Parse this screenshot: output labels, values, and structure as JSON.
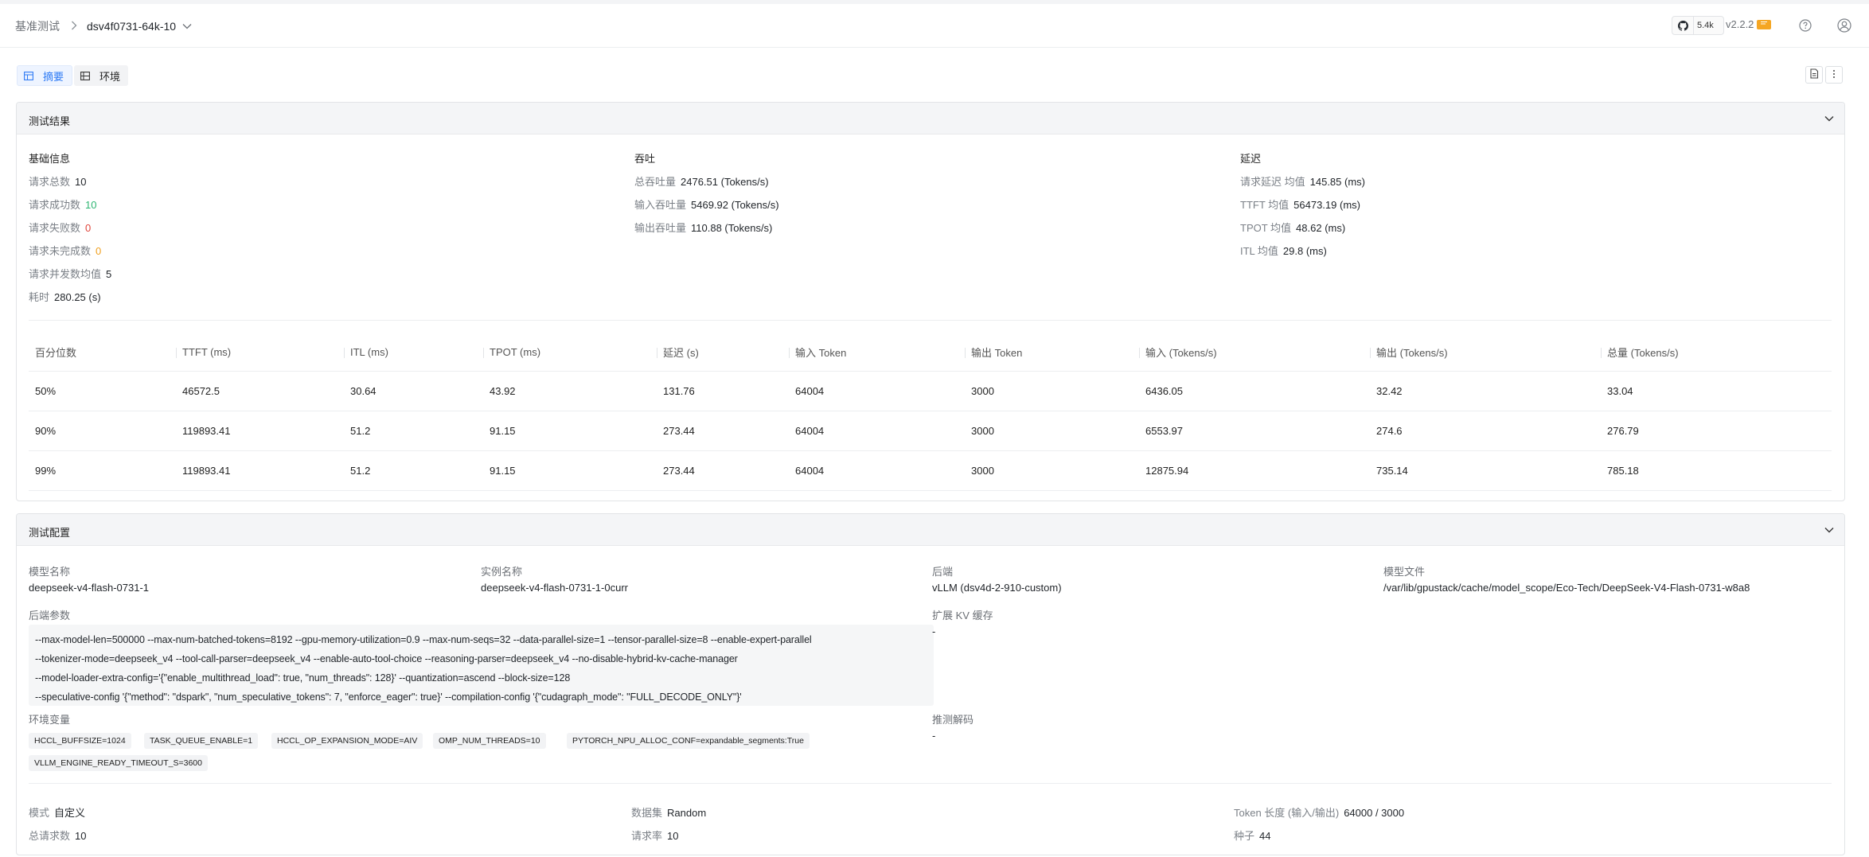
{
  "header": {
    "breadcrumb_root": "基准测试",
    "breadcrumb_current": "dsv4f0731-64k-10",
    "github_stars": "5.4k",
    "version": "v2.2.2"
  },
  "tabs": [
    {
      "label": "摘要"
    },
    {
      "label": "环境"
    }
  ],
  "results": {
    "title": "测试结果",
    "basic": {
      "title": "基础信息",
      "items": [
        {
          "label": "请求总数",
          "value": "10"
        },
        {
          "label": "请求成功数",
          "value": "10"
        },
        {
          "label": "请求失败数",
          "value": "0"
        },
        {
          "label": "请求未完成数",
          "value": "0"
        },
        {
          "label": "请求并发数均值",
          "value": "5"
        },
        {
          "label": "耗时",
          "value": "280.25 (s)"
        }
      ]
    },
    "throughput": {
      "title": "吞吐",
      "items": [
        {
          "label": "总吞吐量",
          "value": "2476.51 (Tokens/s)"
        },
        {
          "label": "输入吞吐量",
          "value": "5469.92 (Tokens/s)"
        },
        {
          "label": "输出吞吐量",
          "value": "110.88 (Tokens/s)"
        }
      ]
    },
    "latency": {
      "title": "延迟",
      "items": [
        {
          "label": "请求延迟 均值",
          "value": "145.85 (ms)"
        },
        {
          "label": "TTFT 均值",
          "value": "56473.19 (ms)"
        },
        {
          "label": "TPOT 均值",
          "value": "48.62 (ms)"
        },
        {
          "label": "ITL 均值",
          "value": "29.8 (ms)"
        }
      ]
    },
    "table": {
      "headers": [
        "百分位数",
        "TTFT (ms)",
        "ITL (ms)",
        "TPOT (ms)",
        "延迟 (s)",
        "输入 Token",
        "输出 Token",
        "输入 (Tokens/s)",
        "输出 (Tokens/s)",
        "总量 (Tokens/s)"
      ],
      "rows": [
        [
          "50%",
          "46572.5",
          "30.64",
          "43.92",
          "131.76",
          "64004",
          "3000",
          "6436.05",
          "32.42",
          "33.04"
        ],
        [
          "90%",
          "119893.41",
          "51.2",
          "91.15",
          "273.44",
          "64004",
          "3000",
          "6553.97",
          "274.6",
          "276.79"
        ],
        [
          "99%",
          "119893.41",
          "51.2",
          "91.15",
          "273.44",
          "64004",
          "3000",
          "12875.94",
          "735.14",
          "785.18"
        ]
      ]
    }
  },
  "config": {
    "title": "测试配置",
    "model_name_label": "模型名称",
    "model_name": "deepseek-v4-flash-0731-1",
    "instance_label": "实例名称",
    "instance": "deepseek-v4-flash-0731-1-0curr",
    "backend_label": "后端",
    "backend": "vLLM (dsv4d-2-910-custom)",
    "model_file_label": "模型文件",
    "model_file": "/var/lib/gpustack/cache/model_scope/Eco-Tech/DeepSeek-V4-Flash-0731-w8a8",
    "backend_args_label": "后端参数",
    "backend_args": [
      "--max-model-len=500000  --max-num-batched-tokens=8192  --gpu-memory-utilization=0.9  --max-num-seqs=32  --data-parallel-size=1  --tensor-parallel-size=8  --enable-expert-parallel",
      "--tokenizer-mode=deepseek_v4  --tool-call-parser=deepseek_v4  --enable-auto-tool-choice  --reasoning-parser=deepseek_v4  --no-disable-hybrid-kv-cache-manager",
      "--model-loader-extra-config='{\"enable_multithread_load\": true, \"num_threads\": 128}'  --quantization=ascend  --block-size=128",
      "--speculative-config '{\"method\": \"dspark\", \"num_speculative_tokens\": 7, \"enforce_eager\": true}'  --compilation-config '{\"cudagraph_mode\": \"FULL_DECODE_ONLY\"}'"
    ],
    "kv_cache_label": "扩展 KV 缓存",
    "kv_cache": "-",
    "env_label": "环境变量",
    "env_vars": [
      "HCCL_BUFFSIZE=1024",
      "TASK_QUEUE_ENABLE=1",
      "HCCL_OP_EXPANSION_MODE=AIV",
      "OMP_NUM_THREADS=10",
      "PYTORCH_NPU_ALLOC_CONF=expandable_segments:True",
      "VLLM_ENGINE_READY_TIMEOUT_S=3600"
    ],
    "spec_decode_label": "推测解码",
    "spec_decode": "-",
    "mode_label": "模式",
    "mode": "自定义",
    "dataset_label": "数据集",
    "dataset": "Random",
    "token_len_label": "Token 长度 (输入/输出)",
    "token_len": "64000 / 3000",
    "total_req_label": "总请求数",
    "total_req": "10",
    "req_rate_label": "请求率",
    "req_rate": "10",
    "seed_label": "种子",
    "seed": "44"
  }
}
